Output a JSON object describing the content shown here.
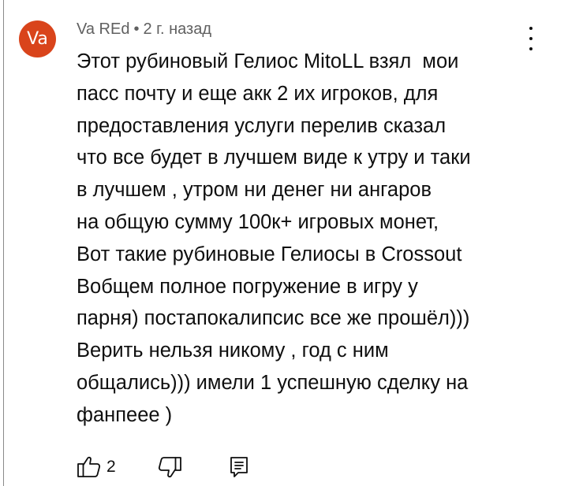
{
  "comment": {
    "avatar_text": "Va",
    "avatar_color": "#d9441b",
    "author": "Va REd",
    "separator": "•",
    "timestamp": "2 г. назад",
    "text_lines": [
      "Этот рубиновый Гелиос MitoLL взял  мои",
      "пасс почту и еще акк 2 их игроков, для",
      "предоставления услуги перелив сказал",
      "что все будет в лучшем виде к утру и таки",
      "в лучшем , утром ни денег ни ангаров",
      "на общую сумму 100к+ игровых монет,",
      "Вот такие рубиновые Гелиосы в Crossout",
      "Вобщем полное погружение в игру у",
      "парня) постапокалипсис все же прошёл)))",
      "Верить нельзя никому , год с ним",
      "общались))) имели 1 успешную сделку на",
      "фанпеее )"
    ],
    "like_count": "2"
  },
  "icons": {
    "more": "more-vertical-icon",
    "like": "thumbs-up-icon",
    "dislike": "thumbs-down-icon",
    "reply": "reply-comment-icon"
  }
}
